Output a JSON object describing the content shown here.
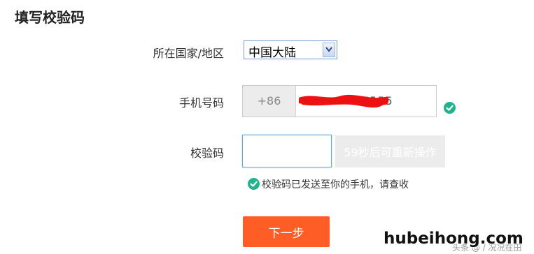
{
  "page": {
    "title": "填写校验码"
  },
  "form": {
    "region_label": "所在国家/地区",
    "region_value": "中国大陆",
    "phone_label": "手机号码",
    "phone_prefix": "+86",
    "phone_visible_tail": "5555",
    "code_label": "校验码",
    "code_value": "",
    "resend_label": "59秒后可重新操作",
    "hint": "校验码已发送至你的手机，请查收",
    "next_label": "下一步"
  },
  "watermark": {
    "site": "hubeihong.com",
    "credit": "头条 @ / 况况在田"
  },
  "colors": {
    "accent_orange": "#ff5c26",
    "success_green": "#22b38e",
    "redaction_red": "#ee1111",
    "input_focus_border": "#6aa8e0"
  },
  "icons": {
    "verified": "check-circle-icon",
    "dropdown": "chevron-down-icon"
  }
}
